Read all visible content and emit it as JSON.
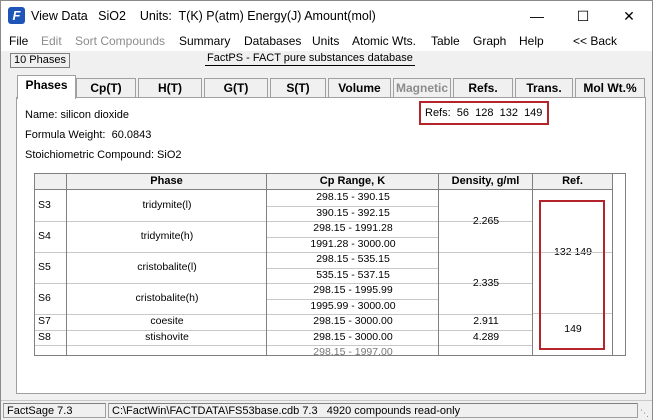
{
  "titlebar": {
    "app_icon": "factsage-logo-icon",
    "title": "View Data   SiO2    Units:  T(K) P(atm) Energy(J) Amount(mol)"
  },
  "menu": [
    {
      "label": "File",
      "enabled": true
    },
    {
      "label": "Edit",
      "enabled": false
    },
    {
      "label": "Sort Compounds",
      "enabled": false
    },
    {
      "label": "Summary",
      "enabled": true
    },
    {
      "label": "Databases",
      "enabled": true
    },
    {
      "label": "Units",
      "enabled": true
    },
    {
      "label": "Atomic Wts.",
      "enabled": true
    },
    {
      "label": "Table",
      "enabled": true
    },
    {
      "label": "Graph",
      "enabled": true
    },
    {
      "label": "Help",
      "enabled": true
    },
    {
      "label": "<< Back",
      "enabled": true
    }
  ],
  "phase_count": "10 Phases",
  "database_name": "FactPS - FACT pure substances database",
  "tabs": [
    {
      "label": "Phases",
      "active": true,
      "enabled": true
    },
    {
      "label": "Cp(T)",
      "active": false,
      "enabled": true
    },
    {
      "label": "H(T)",
      "active": false,
      "enabled": true
    },
    {
      "label": "G(T)",
      "active": false,
      "enabled": true
    },
    {
      "label": "S(T)",
      "active": false,
      "enabled": true
    },
    {
      "label": "Volume",
      "active": false,
      "enabled": true
    },
    {
      "label": "Magnetic",
      "active": false,
      "enabled": false
    },
    {
      "label": "Refs.",
      "active": false,
      "enabled": true
    },
    {
      "label": "Trans.",
      "active": false,
      "enabled": true
    },
    {
      "label": "Mol Wt.%",
      "active": false,
      "enabled": true
    }
  ],
  "compound": {
    "name": "Name: silicon dioxide",
    "formula_weight": "Formula Weight:  60.0843",
    "stoichiometric": "Stoichiometric Compound: SiO2",
    "refs": "Refs:  56  128  132  149"
  },
  "grid": {
    "headers": [
      "Phase",
      "Cp Range, K",
      "Density, g/ml",
      "Ref."
    ],
    "rows": [
      {
        "id": "S3",
        "phase": "tridymite(l)",
        "ranges": [
          "298.15 - 390.15",
          "390.15 - 392.15"
        ],
        "density": "2.265",
        "ref": "132  149"
      },
      {
        "id": "S4",
        "phase": "tridymite(h)",
        "ranges": [
          "298.15 - 1991.28",
          "1991.28 - 3000.00"
        ],
        "density": "",
        "ref": ""
      },
      {
        "id": "S5",
        "phase": "cristobalite(l)",
        "ranges": [
          "298.15 - 535.15",
          "535.15 - 537.15"
        ],
        "density": "2.335",
        "ref": ""
      },
      {
        "id": "S6",
        "phase": "cristobalite(h)",
        "ranges": [
          "298.15 - 1995.99",
          "1995.99 - 3000.00"
        ],
        "density": "",
        "ref": ""
      },
      {
        "id": "S7",
        "phase": "coesite",
        "ranges": [
          "298.15 - 3000.00"
        ],
        "density": "2.911",
        "ref": "149"
      },
      {
        "id": "S8",
        "phase": "stishovite",
        "ranges": [
          "298.15 - 3000.00"
        ],
        "density": "4.289",
        "ref": ""
      }
    ],
    "partial_row_text": "298.15 - 1997.00"
  },
  "statusbar": {
    "app": "FactSage 7.3",
    "path": "C:\\FactWin\\FACTDATA\\FS53base.cdb 7.3   4920 compounds read-only"
  },
  "colors": {
    "highlight_border": "#b3242b",
    "icon_blue": "#1f55b8"
  }
}
